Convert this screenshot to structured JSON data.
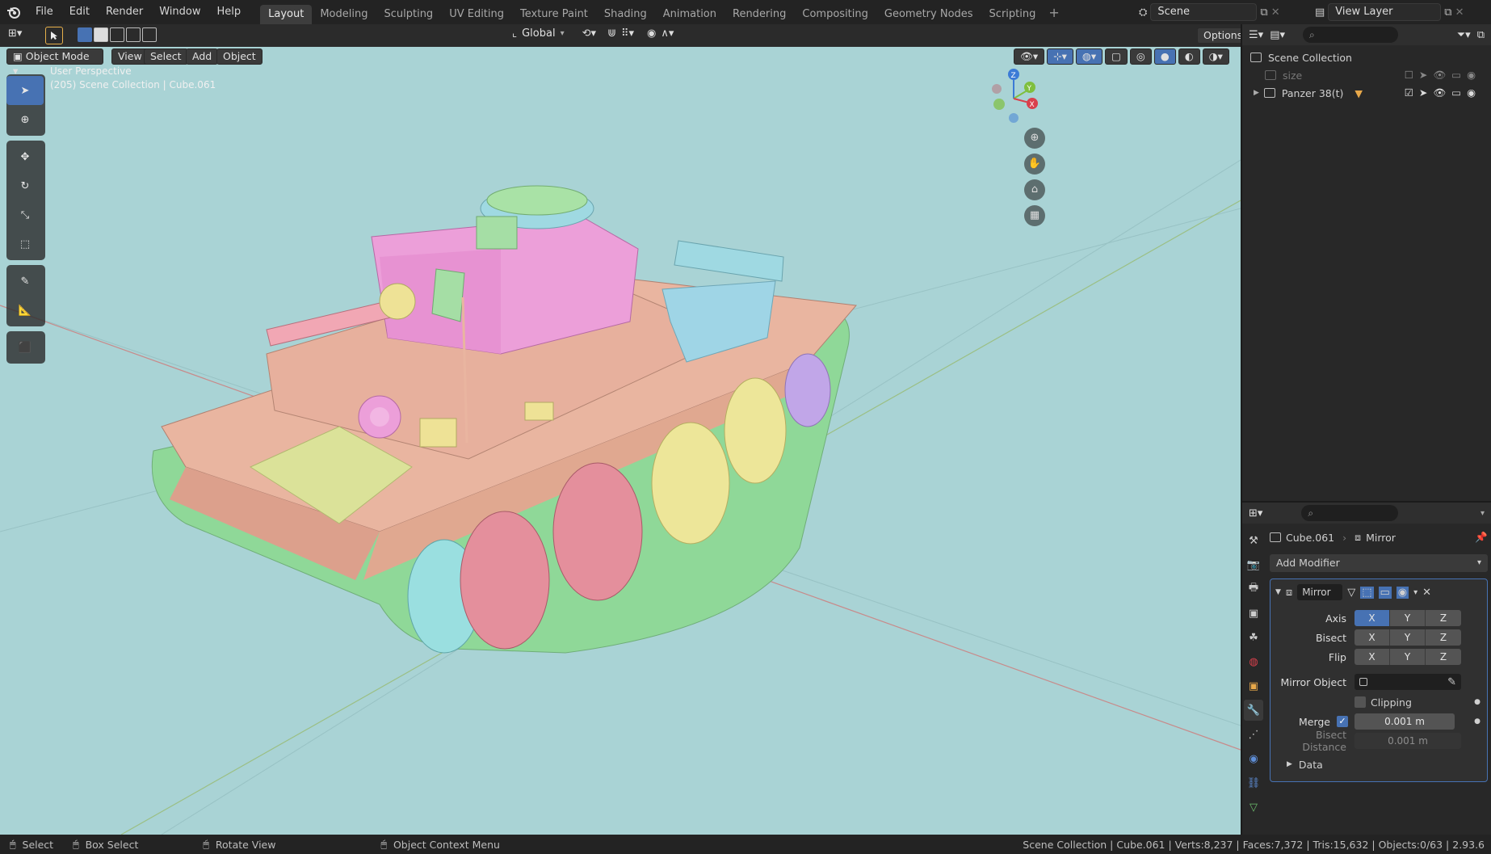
{
  "menu": {
    "logo": "blender-logo",
    "items": [
      "File",
      "Edit",
      "Render",
      "Window",
      "Help"
    ]
  },
  "workspaces": [
    "Layout",
    "Modeling",
    "Sculpting",
    "UV Editing",
    "Texture Paint",
    "Shading",
    "Animation",
    "Rendering",
    "Compositing",
    "Geometry Nodes",
    "Scripting"
  ],
  "active_workspace": "Layout",
  "scene": {
    "name": "Scene",
    "view_layer": "View Layer"
  },
  "header": {
    "transform_orientation": "Global",
    "options_label": "Options"
  },
  "viewport_header": {
    "mode": "Object Mode",
    "menus": [
      "View",
      "Select",
      "Add",
      "Object"
    ]
  },
  "viewport": {
    "perspective": "User Perspective",
    "context": "(205) Scene Collection | Cube.061",
    "background": "#a9d3d5",
    "gizmo": {
      "x": "X",
      "y": "Y",
      "z": "Z"
    }
  },
  "outliner": {
    "root": "Scene Collection",
    "items": [
      {
        "name": "size"
      },
      {
        "name": "Panzer 38(t)"
      }
    ]
  },
  "properties": {
    "object": "Cube.061",
    "modifier_name": "Mirror",
    "add_modifier": "Add Modifier",
    "rows": {
      "axis": "Axis",
      "bisect": "Bisect",
      "flip": "Flip",
      "mirror_object": "Mirror Object",
      "clipping": "Clipping",
      "merge": "Merge",
      "bisect_distance": "Bisect Distance",
      "data": "Data"
    },
    "axes": [
      "X",
      "Y",
      "Z"
    ],
    "merge_value": "0.001 m",
    "bisect_distance_value": "0.001 m"
  },
  "status": {
    "select": "Select",
    "box_select": "Box Select",
    "rotate": "Rotate View",
    "context_menu": "Object Context Menu",
    "info": "Scene Collection | Cube.061 | Verts:8,237 | Faces:7,372 | Tris:15,632 | Objects:0/63 | 2.93.6"
  }
}
